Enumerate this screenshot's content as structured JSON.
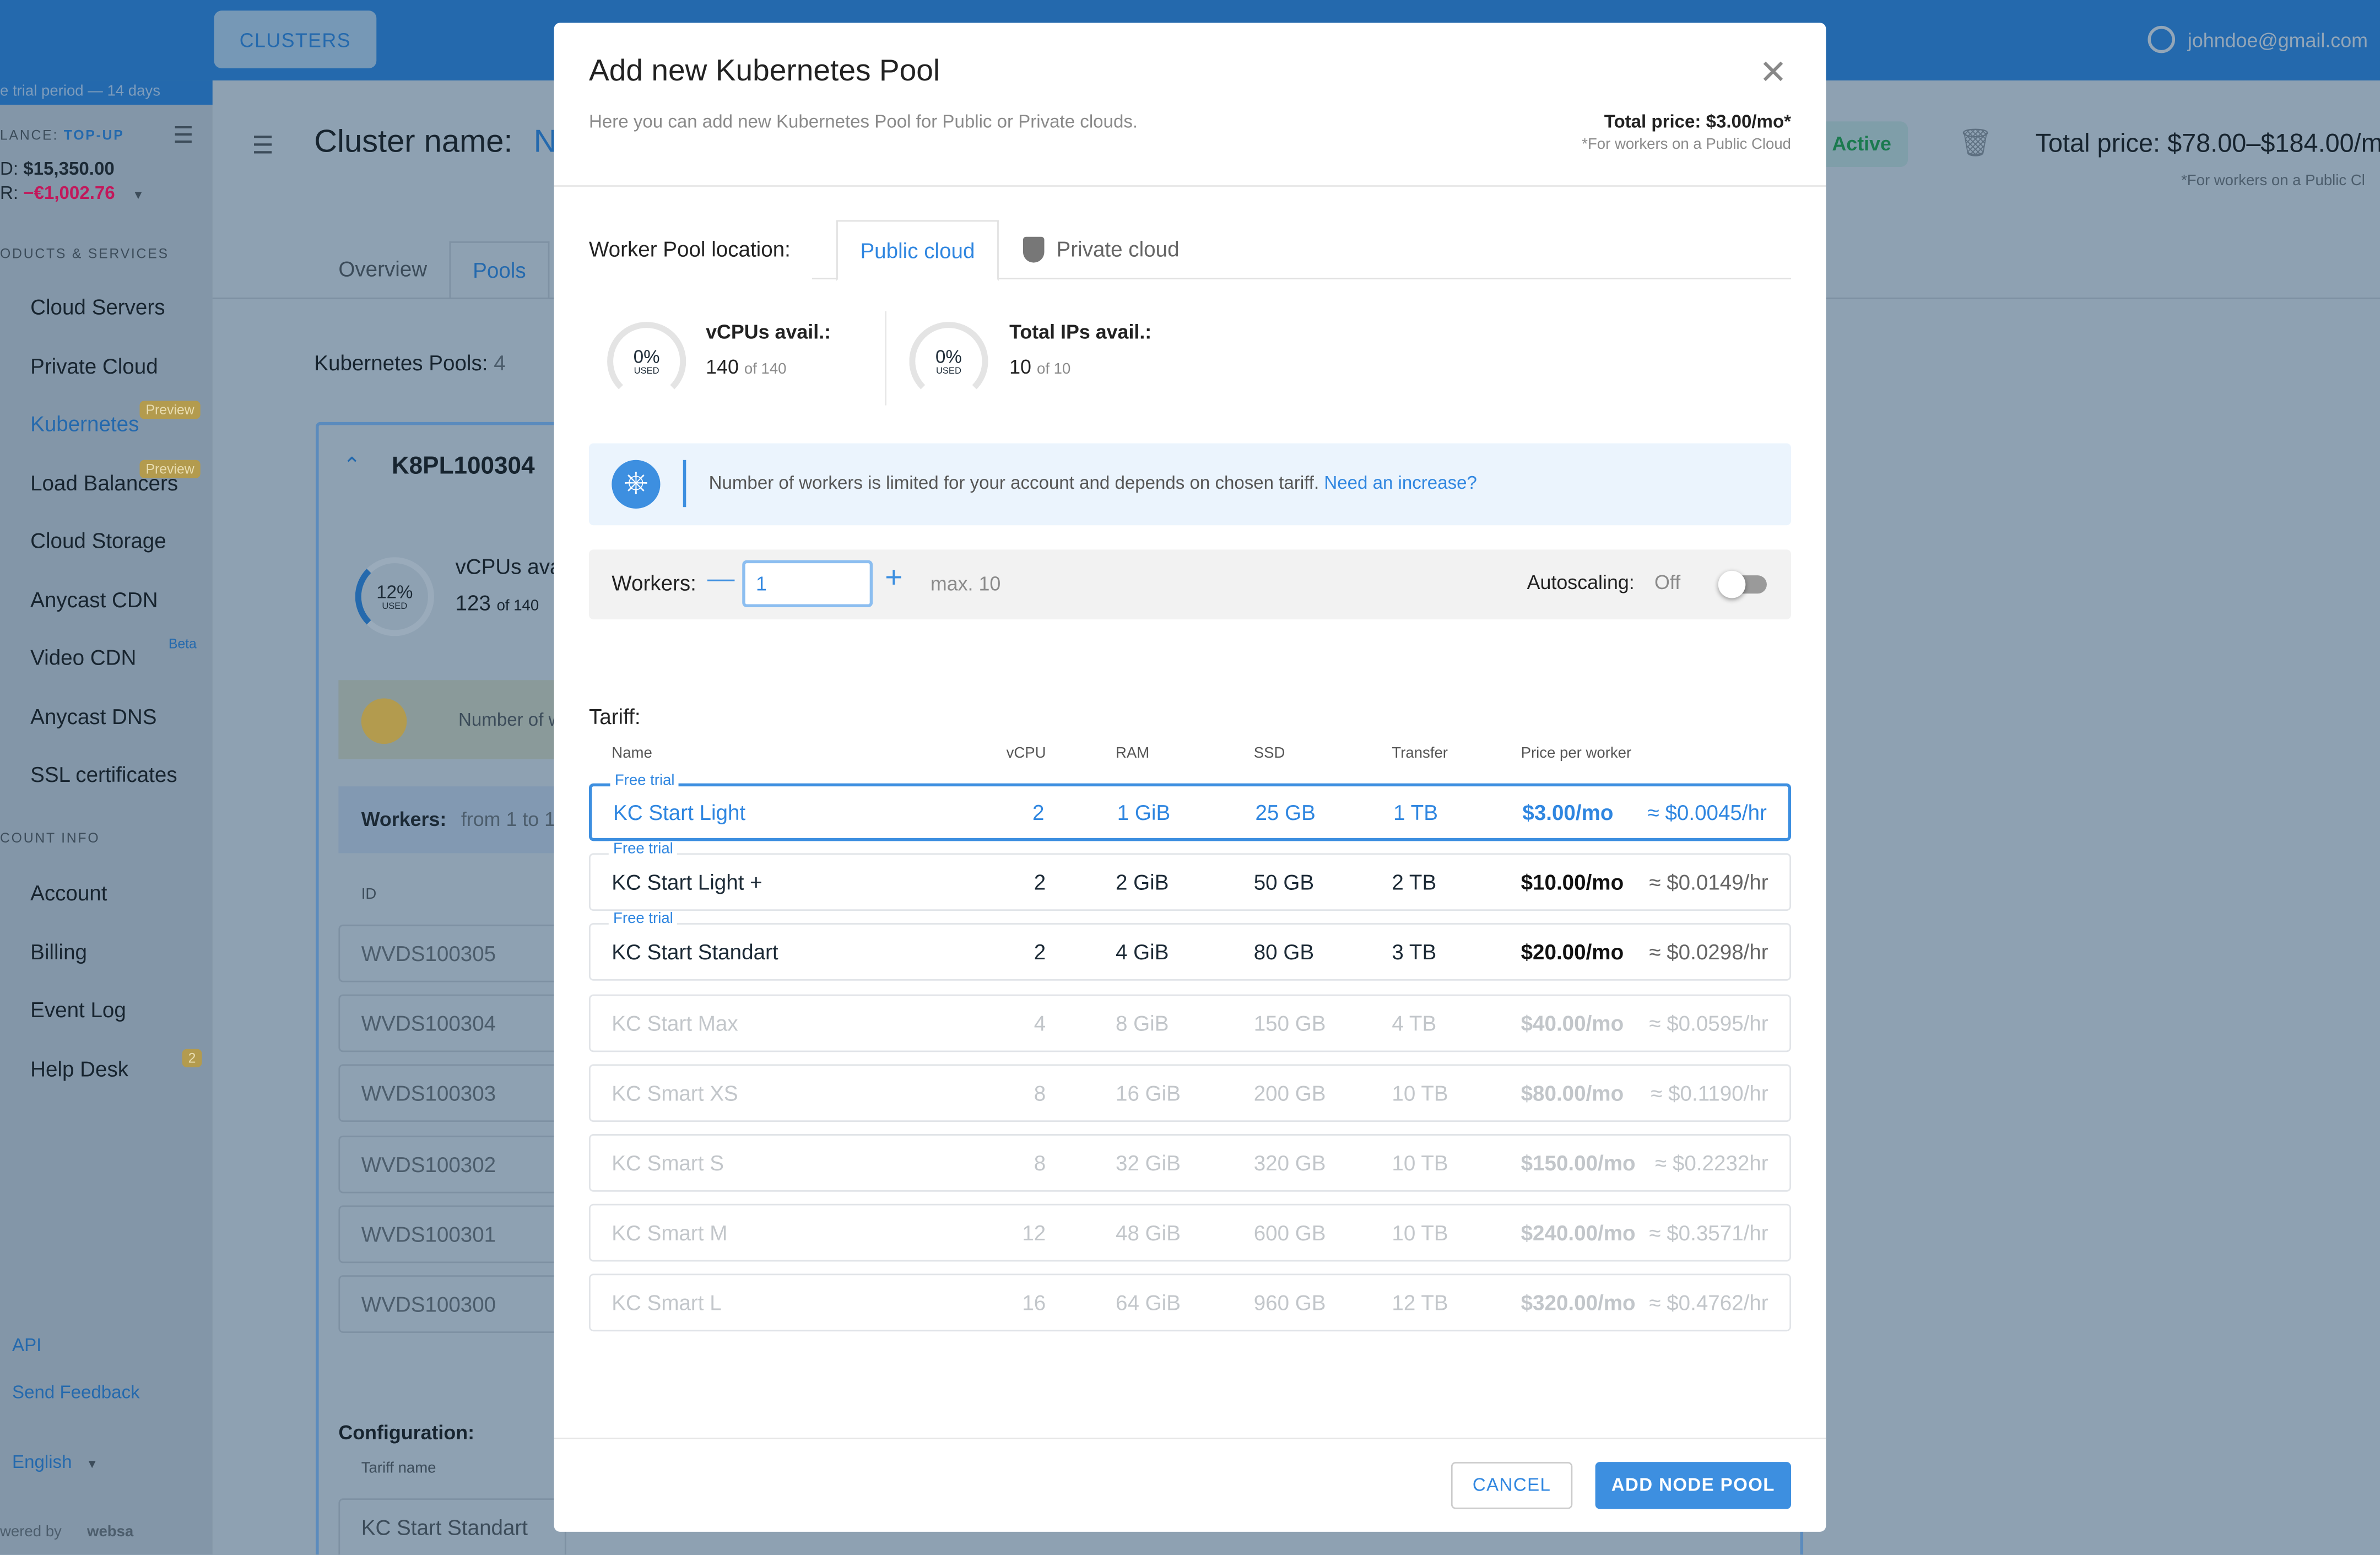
{
  "header": {
    "clusters_tab": "CLUSTERS",
    "user_email": "johndoe@gmail.com"
  },
  "sidebar": {
    "trial": "e trial period — 14 days",
    "balance_label": "LANCE:",
    "topup": "TOP-UP",
    "usd_label": "D:",
    "usd": "$15,350.00",
    "eur_label": "R:",
    "eur": "−€1,002.76",
    "products_heading": "ODUCTS & SERVICES",
    "items": [
      {
        "label": "Cloud Servers"
      },
      {
        "label": "Private Cloud"
      },
      {
        "label": "Kubernetes",
        "badge": "Preview"
      },
      {
        "label": "Load Balancers",
        "badge": "Preview"
      },
      {
        "label": "Cloud Storage"
      },
      {
        "label": "Anycast CDN"
      },
      {
        "label": "Video CDN",
        "badge": "Beta"
      },
      {
        "label": "Anycast DNS"
      },
      {
        "label": "SSL certificates"
      }
    ],
    "account_heading": "COUNT INFO",
    "account_items": [
      {
        "label": "Account"
      },
      {
        "label": "Billing"
      },
      {
        "label": "Event Log"
      },
      {
        "label": "Help Desk",
        "badge": "2"
      }
    ],
    "api": "API",
    "feedback": "Send Feedback",
    "language": "English",
    "powered": "wered by",
    "brand": "websa"
  },
  "page": {
    "cluster_label": "Cluster name:",
    "cluster_value": "N",
    "status": "Active",
    "total_price": "Total price: $78.00–$184.00/m",
    "price_note": "*For workers on a Public Cl",
    "tabs": [
      "Overview",
      "Pools"
    ],
    "pools_label": "Kubernetes Pools:",
    "pools_count": "4",
    "pool_name": "K8PL100304",
    "usage_pct": "12%",
    "used": "USED",
    "vcpu_label": "vCPUs ava",
    "vcpu_value": "123",
    "vcpu_of": "of 140",
    "notice": "Number of w",
    "workers_label": "Workers:",
    "workers_range": "from 1 to 1",
    "id_header": "ID",
    "ids": [
      "WVDS100305",
      "WVDS100304",
      "WVDS100303",
      "WVDS100302",
      "WVDS100301",
      "WVDS100300"
    ],
    "config_label": "Configuration:",
    "tariff_name_header": "Tariff name",
    "tariff_name": "KC Start Standart"
  },
  "modal": {
    "title": "Add new Kubernetes Pool",
    "subtitle": "Here you can add new Kubernetes Pool for Public or Private clouds.",
    "total_price": "Total price: $3.00/mo*",
    "price_note": "*For workers on a Public Cloud",
    "location_label": "Worker Pool location:",
    "tabs": [
      "Public cloud",
      "Private cloud"
    ],
    "vcpu": {
      "pct": "0%",
      "used": "USED",
      "label": "vCPUs avail.:",
      "value": "140",
      "of": "of 140"
    },
    "ips": {
      "pct": "0%",
      "used": "USED",
      "label": "Total IPs avail.:",
      "value": "10",
      "of": "of 10"
    },
    "notice": "Number of workers is limited for your account and depends on chosen tariff.",
    "notice_link": "Need an increase?",
    "workers_label": "Workers:",
    "workers_value": "1",
    "workers_max": "max. 10",
    "autoscaling_label": "Autoscaling:",
    "autoscaling_value": "Off",
    "autoscaling_on": false,
    "tariff_label": "Tariff:",
    "columns": [
      "Name",
      "vCPU",
      "RAM",
      "SSD",
      "Transfer",
      "Price per worker"
    ],
    "tariffs": [
      {
        "flag": "Free trial",
        "name": "KC Start Light",
        "vcpu": "2",
        "ram": "1 GiB",
        "ssd": "25 GB",
        "transfer": "1 TB",
        "price": "$3.00/mo",
        "hourly": "≈ $0.0045/hr",
        "state": "selected"
      },
      {
        "flag": "Free trial",
        "name": "KC Start Light +",
        "vcpu": "2",
        "ram": "2 GiB",
        "ssd": "50 GB",
        "transfer": "2 TB",
        "price": "$10.00/mo",
        "hourly": "≈ $0.0149/hr",
        "state": "enabled"
      },
      {
        "flag": "Free trial",
        "name": "KC Start Standart",
        "vcpu": "2",
        "ram": "4 GiB",
        "ssd": "80 GB",
        "transfer": "3 TB",
        "price": "$20.00/mo",
        "hourly": "≈ $0.0298/hr",
        "state": "enabled"
      },
      {
        "name": "KC Start Max",
        "vcpu": "4",
        "ram": "8 GiB",
        "ssd": "150 GB",
        "transfer": "4 TB",
        "price": "$40.00/mo",
        "hourly": "≈ $0.0595/hr",
        "state": "disabled"
      },
      {
        "name": "KC Smart XS",
        "vcpu": "8",
        "ram": "16 GiB",
        "ssd": "200 GB",
        "transfer": "10 TB",
        "price": "$80.00/mo",
        "hourly": "≈ $0.1190/hr",
        "state": "disabled"
      },
      {
        "name": "KC Smart S",
        "vcpu": "8",
        "ram": "32 GiB",
        "ssd": "320 GB",
        "transfer": "10 TB",
        "price": "$150.00/mo",
        "hourly": "≈ $0.2232hr",
        "state": "disabled"
      },
      {
        "name": "KC Smart M",
        "vcpu": "12",
        "ram": "48 GiB",
        "ssd": "600 GB",
        "transfer": "10 TB",
        "price": "$240.00/mo",
        "hourly": "≈ $0.3571/hr",
        "state": "disabled"
      },
      {
        "name": "KC Smart L",
        "vcpu": "16",
        "ram": "64 GiB",
        "ssd": "960 GB",
        "transfer": "12 TB",
        "price": "$320.00/mo",
        "hourly": "≈ $0.4762/hr",
        "state": "disabled"
      }
    ],
    "cancel": "CANCEL",
    "submit": "ADD NODE POOL"
  },
  "colors": {
    "header": "#2469ad",
    "accent": "#2f86e0",
    "danger": "#c2185b",
    "active": "#1b7a4f"
  }
}
